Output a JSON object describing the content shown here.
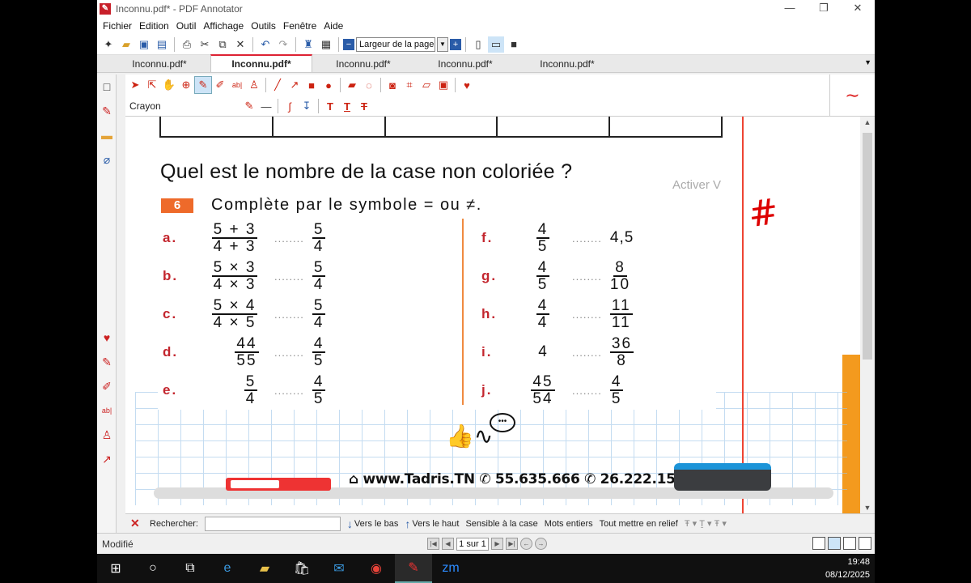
{
  "window": {
    "title": "Inconnu.pdf* - PDF Annotator",
    "app_icon": "pdf-annotator-icon"
  },
  "menu": [
    "Fichier",
    "Edition",
    "Outil",
    "Affichage",
    "Outils",
    "Fenêtre",
    "Aide"
  ],
  "toolbar": {
    "zoom_label": "Largeur de la page"
  },
  "tabs": [
    {
      "label": "Inconnu.pdf*",
      "active": false
    },
    {
      "label": "Inconnu.pdf*",
      "active": true
    },
    {
      "label": "Inconnu.pdf*",
      "active": false
    },
    {
      "label": "Inconnu.pdf*",
      "active": false
    },
    {
      "label": "Inconnu.pdf*",
      "active": false
    }
  ],
  "annotation_tools": {
    "current_tool": "Crayon",
    "selected": "pen-icon"
  },
  "document": {
    "question": "Quel est le nombre de la case non coloriée ?",
    "watermark": "Activer V",
    "exercise_number": "6",
    "exercise_title": "Complète par le symbole = ou ≠.",
    "items_left": [
      {
        "label": "a.",
        "left": {
          "num": "5 + 3",
          "den": "4 + 3"
        },
        "right": {
          "num": "5",
          "den": "4"
        }
      },
      {
        "label": "b.",
        "left": {
          "num": "5 × 3",
          "den": "4 × 3"
        },
        "right": {
          "num": "5",
          "den": "4"
        }
      },
      {
        "label": "c.",
        "left": {
          "num": "5 × 4",
          "den": "4 × 5"
        },
        "right": {
          "num": "5",
          "den": "4"
        }
      },
      {
        "label": "d.",
        "left": {
          "num": "44",
          "den": "55"
        },
        "right": {
          "num": "4",
          "den": "5"
        }
      },
      {
        "label": "e.",
        "left": {
          "num": "5",
          "den": "4"
        },
        "right": {
          "num": "4",
          "den": "5"
        }
      }
    ],
    "items_right": [
      {
        "label": "f.",
        "left": {
          "num": "4",
          "den": "5"
        },
        "right_plain": "4,5"
      },
      {
        "label": "g.",
        "left": {
          "num": "4",
          "den": "5"
        },
        "right": {
          "num": "8",
          "den": "10"
        }
      },
      {
        "label": "h.",
        "left": {
          "num": "4",
          "den": "4"
        },
        "right": {
          "num": "11",
          "den": "11"
        }
      },
      {
        "label": "i.",
        "left_plain": "4",
        "right": {
          "num": "36",
          "den": "8"
        }
      },
      {
        "label": "j.",
        "left": {
          "num": "45",
          "den": "54"
        },
        "right": {
          "num": "4",
          "den": "5"
        }
      }
    ],
    "dots": "........",
    "contact": "www.Tadris.TN  ✆ 55.635.666  ✆ 26.222.159",
    "handwritten_mark": "#"
  },
  "search": {
    "label": "Rechercher:",
    "value": "",
    "down": "Vers le bas",
    "up": "Vers le haut",
    "match_case": "Sensible à la case",
    "whole_words": "Mots entiers",
    "highlight_all": "Tout mettre en relief"
  },
  "status": {
    "text": "Modifié",
    "page": "1 sur 1"
  },
  "clock": {
    "time": "19:48",
    "date": "08/12/2025"
  }
}
